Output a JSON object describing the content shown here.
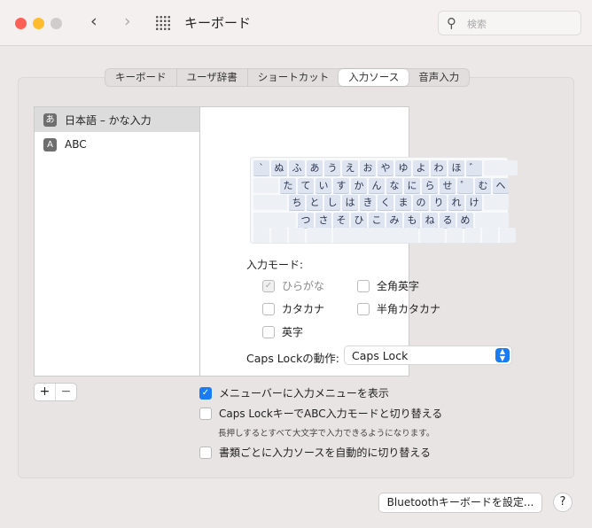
{
  "window": {
    "title": "キーボード",
    "search_placeholder": "検索"
  },
  "tabs": [
    "キーボード",
    "ユーザ辞書",
    "ショートカット",
    "入力ソース",
    "音声入力"
  ],
  "active_tab": "入力ソース",
  "sources": [
    {
      "badge": "あ",
      "label": "日本語 – かな入力",
      "selected": true
    },
    {
      "badge": "A",
      "label": "ABC",
      "selected": false
    }
  ],
  "keyboard": {
    "rows": [
      [
        "`",
        "ぬ",
        "ふ",
        "あ",
        "う",
        "え",
        "お",
        "や",
        "ゆ",
        "よ",
        "わ",
        "ほ",
        "゛"
      ],
      [
        "た",
        "て",
        "い",
        "す",
        "か",
        "ん",
        "な",
        "に",
        "ら",
        "せ",
        "゜",
        "む",
        "へ"
      ],
      [
        "ち",
        "と",
        "し",
        "は",
        "き",
        "く",
        "ま",
        "の",
        "り",
        "れ",
        "け"
      ],
      [
        "つ",
        "さ",
        "そ",
        "ひ",
        "こ",
        "み",
        "も",
        "ね",
        "る",
        "め"
      ]
    ]
  },
  "input_mode": {
    "label": "入力モード:",
    "options": [
      {
        "label": "ひらがな",
        "checked": true,
        "disabled": true
      },
      {
        "label": "全角英字",
        "checked": false
      },
      {
        "label": "カタカナ",
        "checked": false
      },
      {
        "label": "半角カタカナ",
        "checked": false
      },
      {
        "label": "英字",
        "checked": false
      }
    ]
  },
  "caps_lock": {
    "label": "Caps Lockの動作:",
    "value": "Caps Lock"
  },
  "list_buttons": {
    "add": "+",
    "remove": "−"
  },
  "options": [
    {
      "label": "メニューバーに入力メニューを表示",
      "checked": true
    },
    {
      "label": "Caps LockキーでABC入力モードと切り替える",
      "checked": false,
      "note": "長押しするとすべて大文字で入力できるようになります。"
    },
    {
      "label": "書類ごとに入力ソースを自動的に切り替える",
      "checked": false
    }
  ],
  "bluetooth_button": "Bluetoothキーボードを設定...",
  "help": "?",
  "colors": {
    "accent": "#1a7cf2",
    "close": "#fe5f57",
    "minimize": "#febc2e",
    "zoom": "#d0cccc"
  }
}
